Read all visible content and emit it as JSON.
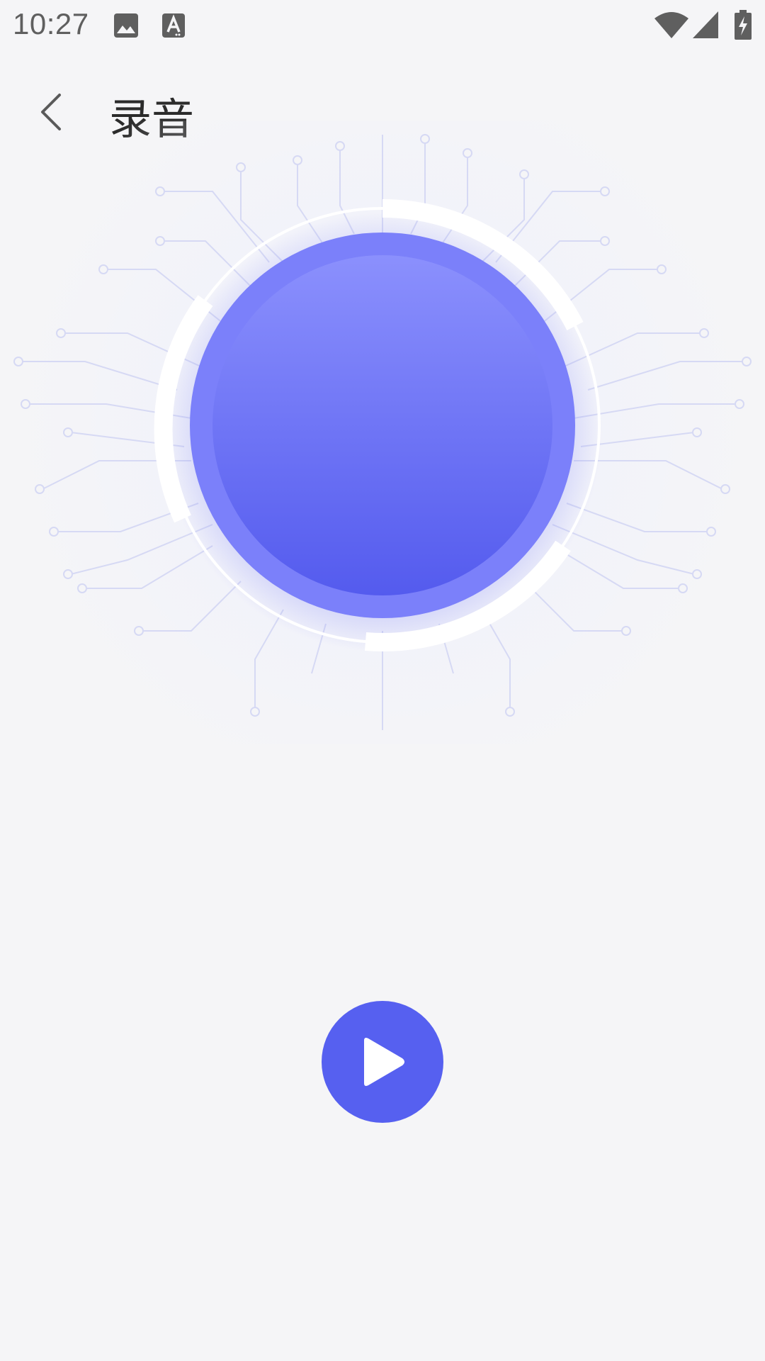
{
  "status_bar": {
    "time": "10:27",
    "icons": [
      "image-icon",
      "text-a-icon",
      "wifi-icon",
      "cell-signal-icon",
      "battery-charging-icon"
    ]
  },
  "app_bar": {
    "title": "录音",
    "back_icon": "chevron-left-icon"
  },
  "recorder": {
    "orb_icon": "record-orb",
    "play_icon": "play-icon"
  },
  "colors": {
    "background": "#f5f5f7",
    "accent": "#5660f0",
    "orb_top": "#8a8ffc",
    "orb_bottom": "#545bee",
    "circuit": "#d9dcf5"
  }
}
